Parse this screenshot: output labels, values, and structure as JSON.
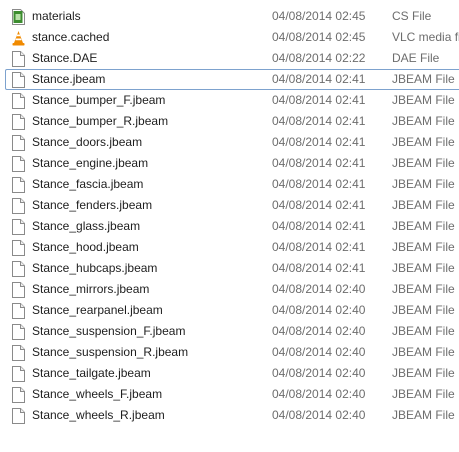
{
  "files": [
    {
      "name": "materials",
      "date": "04/08/2014 02:45",
      "type": "CS File",
      "icon": "cs-file-icon",
      "focused": false
    },
    {
      "name": "stance.cached",
      "date": "04/08/2014 02:45",
      "type": "VLC media file",
      "icon": "vlc-cone-icon",
      "focused": false
    },
    {
      "name": "Stance.DAE",
      "date": "04/08/2014 02:22",
      "type": "DAE File",
      "icon": "blank-document-icon",
      "focused": false
    },
    {
      "name": "Stance.jbeam",
      "date": "04/08/2014 02:41",
      "type": "JBEAM File",
      "icon": "blank-document-icon",
      "focused": true
    },
    {
      "name": "Stance_bumper_F.jbeam",
      "date": "04/08/2014 02:41",
      "type": "JBEAM File",
      "icon": "blank-document-icon",
      "focused": false
    },
    {
      "name": "Stance_bumper_R.jbeam",
      "date": "04/08/2014 02:41",
      "type": "JBEAM File",
      "icon": "blank-document-icon",
      "focused": false
    },
    {
      "name": "Stance_doors.jbeam",
      "date": "04/08/2014 02:41",
      "type": "JBEAM File",
      "icon": "blank-document-icon",
      "focused": false
    },
    {
      "name": "Stance_engine.jbeam",
      "date": "04/08/2014 02:41",
      "type": "JBEAM File",
      "icon": "blank-document-icon",
      "focused": false
    },
    {
      "name": "Stance_fascia.jbeam",
      "date": "04/08/2014 02:41",
      "type": "JBEAM File",
      "icon": "blank-document-icon",
      "focused": false
    },
    {
      "name": "Stance_fenders.jbeam",
      "date": "04/08/2014 02:41",
      "type": "JBEAM File",
      "icon": "blank-document-icon",
      "focused": false
    },
    {
      "name": "Stance_glass.jbeam",
      "date": "04/08/2014 02:41",
      "type": "JBEAM File",
      "icon": "blank-document-icon",
      "focused": false
    },
    {
      "name": "Stance_hood.jbeam",
      "date": "04/08/2014 02:41",
      "type": "JBEAM File",
      "icon": "blank-document-icon",
      "focused": false
    },
    {
      "name": "Stance_hubcaps.jbeam",
      "date": "04/08/2014 02:41",
      "type": "JBEAM File",
      "icon": "blank-document-icon",
      "focused": false
    },
    {
      "name": "Stance_mirrors.jbeam",
      "date": "04/08/2014 02:40",
      "type": "JBEAM File",
      "icon": "blank-document-icon",
      "focused": false
    },
    {
      "name": "Stance_rearpanel.jbeam",
      "date": "04/08/2014 02:40",
      "type": "JBEAM File",
      "icon": "blank-document-icon",
      "focused": false
    },
    {
      "name": "Stance_suspension_F.jbeam",
      "date": "04/08/2014 02:40",
      "type": "JBEAM File",
      "icon": "blank-document-icon",
      "focused": false
    },
    {
      "name": "Stance_suspension_R.jbeam",
      "date": "04/08/2014 02:40",
      "type": "JBEAM File",
      "icon": "blank-document-icon",
      "focused": false
    },
    {
      "name": "Stance_tailgate.jbeam",
      "date": "04/08/2014 02:40",
      "type": "JBEAM File",
      "icon": "blank-document-icon",
      "focused": false
    },
    {
      "name": "Stance_wheels_F.jbeam",
      "date": "04/08/2014 02:40",
      "type": "JBEAM File",
      "icon": "blank-document-icon",
      "focused": false
    },
    {
      "name": "Stance_wheels_R.jbeam",
      "date": "04/08/2014 02:40",
      "type": "JBEAM File",
      "icon": "blank-document-icon",
      "focused": false
    }
  ],
  "colors": {
    "focus_border": "#7da2ce",
    "name_text": "#1e1e1e",
    "meta_text": "#6d6d6d",
    "cs_icon_green": "#3c8d2f",
    "vlc_orange": "#f08a00"
  }
}
